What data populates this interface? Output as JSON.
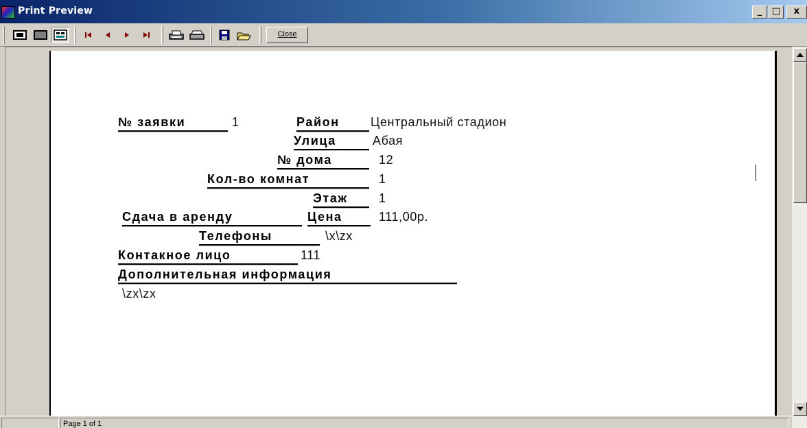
{
  "window": {
    "title": "Print Preview",
    "minimize_label": "_",
    "maximize_label": "□",
    "close_label": "x"
  },
  "toolbar": {
    "close_label": "Close",
    "buttons": [
      "whole-page-icon",
      "page-width-icon",
      "zoom-icon",
      "first-page-icon",
      "previous-page-icon",
      "next-page-icon",
      "last-page-icon",
      "print-setup-icon",
      "print-icon",
      "save-icon",
      "open-icon"
    ]
  },
  "status": {
    "page_text": "Page 1 of 1"
  },
  "report": {
    "request_no_label": "№ заявки",
    "request_no_value": "1",
    "district_label": "Район",
    "district_value": "Центральный стадион",
    "street_label": "Улица",
    "street_value": "Абая",
    "house_label": "№ дома",
    "house_value": "12",
    "rooms_label": "Кол-во комнат",
    "rooms_value": "1",
    "floor_label": "Этаж",
    "floor_value": "1",
    "rent_label": "Сдача в аренду",
    "price_label": "Цена",
    "price_value": "111,00р.",
    "phones_label": "Телефоны",
    "phones_value": "\\x\\zx",
    "contact_label": "Контакное лицо",
    "contact_value": "111",
    "extra_label": "Дополнительная информация",
    "extra_value": "\\zx\\zx"
  },
  "colors": {
    "titlebar_start": "#0a246a",
    "titlebar_end": "#a6caf0",
    "chrome": "#d4d0c8"
  }
}
